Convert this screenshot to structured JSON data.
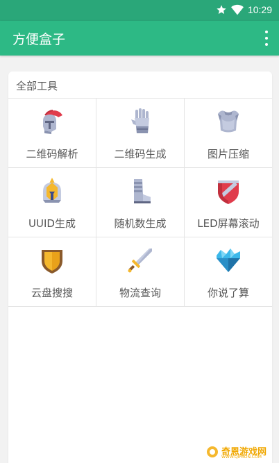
{
  "status": {
    "time": "10:29"
  },
  "app_bar": {
    "title": "方便盒子"
  },
  "section": {
    "title": "全部工具"
  },
  "tools": [
    {
      "label": "二维码解析",
      "icon": "spartan-helmet-icon"
    },
    {
      "label": "二维码生成",
      "icon": "gauntlet-icon"
    },
    {
      "label": "图片压缩",
      "icon": "armor-vest-icon"
    },
    {
      "label": "UUID生成",
      "icon": "knight-helmet-icon"
    },
    {
      "label": "随机数生成",
      "icon": "armored-boot-icon"
    },
    {
      "label": "LED屏幕滚动",
      "icon": "crest-shield-icon"
    },
    {
      "label": "云盘搜搜",
      "icon": "gold-shield-icon"
    },
    {
      "label": "物流查询",
      "icon": "sword-icon"
    },
    {
      "label": "你说了算",
      "icon": "crystal-icon"
    }
  ],
  "watermark": {
    "text": "奇恩游戏网",
    "sub": "WWW.QIPAON.COM"
  }
}
